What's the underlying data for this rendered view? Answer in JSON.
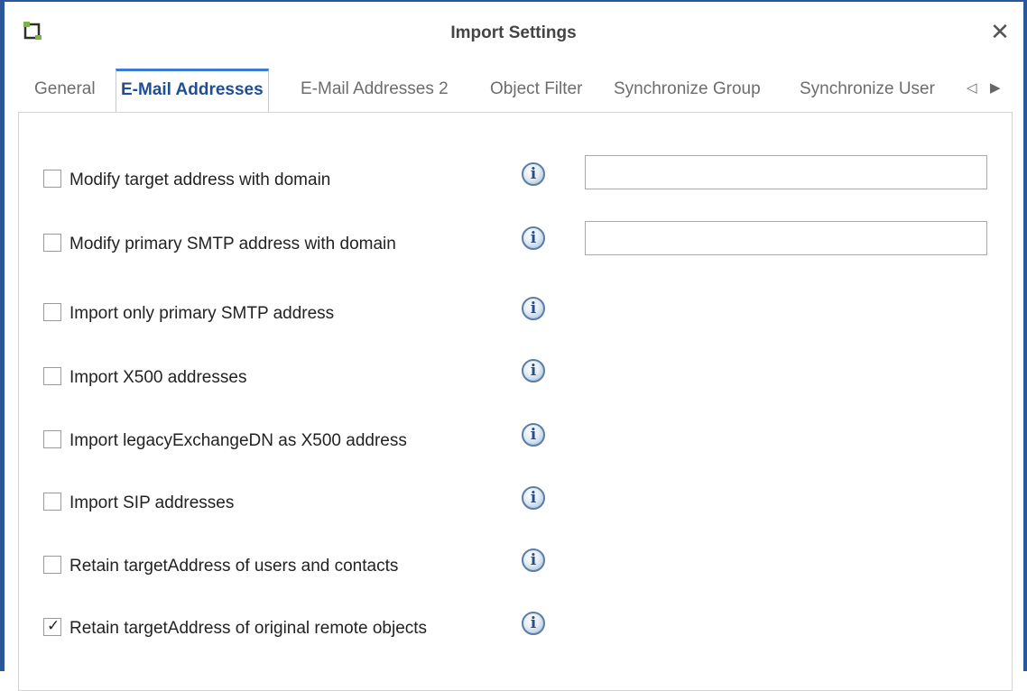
{
  "window": {
    "title": "Import Settings",
    "close_glyph": "✕",
    "icon": "app-icon"
  },
  "tabs": [
    {
      "label": "General",
      "active": false
    },
    {
      "label": "E-Mail Addresses",
      "active": true
    },
    {
      "label": "E-Mail Addresses 2",
      "active": false
    },
    {
      "label": "Object Filter",
      "active": false
    },
    {
      "label": "Synchronize Group",
      "active": false
    },
    {
      "label": "Synchronize User",
      "active": false
    }
  ],
  "tab_nav": {
    "prev_glyph": "◁",
    "next_glyph": "▶"
  },
  "options": [
    {
      "label": "Modify target address with domain",
      "checked": false,
      "input_value": ""
    },
    {
      "label": "Modify primary SMTP address with domain",
      "checked": false,
      "input_value": ""
    },
    {
      "label": "Import only primary SMTP address",
      "checked": false
    },
    {
      "label": "Import X500 addresses",
      "checked": false
    },
    {
      "label": "Import legacyExchangeDN as X500 address",
      "checked": false
    },
    {
      "label": "Import SIP addresses",
      "checked": false
    },
    {
      "label": "Retain targetAddress of users and contacts",
      "checked": false
    },
    {
      "label": "Retain targetAddress of original remote objects",
      "checked": true
    }
  ],
  "info_glyph": "i",
  "check_glyph": "✓",
  "colors": {
    "frame": "#2b579a",
    "active_tab_text": "#1f4e96",
    "active_tab_accent": "#3b7bd4"
  }
}
